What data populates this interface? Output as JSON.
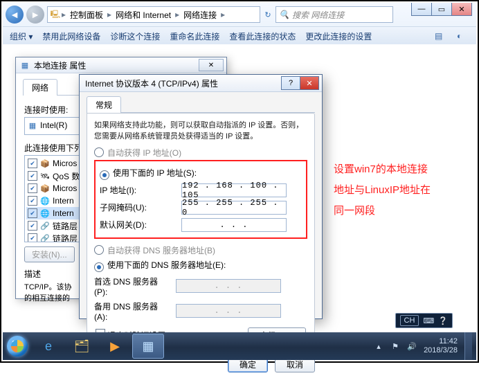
{
  "explorer": {
    "breadcrumbs": [
      "控制面板",
      "网络和 Internet",
      "网络连接"
    ],
    "search_placeholder": "搜索 网络连接",
    "commands": {
      "organize": "组织 ▾",
      "disable": "禁用此网络设备",
      "diagnose": "诊断这个连接",
      "rename": "重命名此连接",
      "status": "查看此连接的状态",
      "change": "更改此连接的设置"
    }
  },
  "win1": {
    "title": "本地连接 属性",
    "tab": "网络",
    "connect_label": "连接时使用:",
    "adapter": "Intel(R)",
    "items_label": "此连接使用下列项目(O):",
    "items": [
      {
        "chk": "✔",
        "icon": "📦",
        "text": "Micros"
      },
      {
        "chk": "✔",
        "icon": "🛰",
        "text": "QoS 数"
      },
      {
        "chk": "✔",
        "icon": "📦",
        "text": "Micros"
      },
      {
        "chk": "✔",
        "icon": "🌐",
        "text": "Intern"
      },
      {
        "chk": "✔",
        "icon": "🌐",
        "text": "Intern"
      },
      {
        "chk": "✔",
        "icon": "🔗",
        "text": "链路层"
      },
      {
        "chk": "✔",
        "icon": "🔗",
        "text": "链路层"
      }
    ],
    "install": "安装(N)...",
    "desc_label": "描述",
    "desc": "TCP/IP。该协\n的相互连接的"
  },
  "win2": {
    "title": "Internet 协议版本 4 (TCP/IPv4) 属性",
    "tab": "常规",
    "note": "如果网络支持此功能，则可以获取自动指派的 IP 设置。否则，\n您需要从网络系统管理员处获得适当的 IP 设置。",
    "auto_ip": "自动获得 IP 地址(O)",
    "use_ip": "使用下面的 IP 地址(S):",
    "ip_label": "IP 地址(I):",
    "ip": "192 . 168 . 100 . 105",
    "mask_label": "子网掩码(U):",
    "mask": "255 . 255 . 255 .  0 ",
    "gw_label": "默认网关(D):",
    "gw": " .     .     .   ",
    "auto_dns": "自动获得 DNS 服务器地址(B)",
    "use_dns": "使用下面的 DNS 服务器地址(E):",
    "dns1_label": "首选 DNS 服务器(P):",
    "dns2_label": "备用 DNS 服务器(A):",
    "dns_blank": " .     .     .   ",
    "validate": "退出时验证设置(L)",
    "advanced": "高级(V)...",
    "ok": "确定",
    "cancel": "取消"
  },
  "annot": {
    "l1": "设置win7的本地连接",
    "l2": "地址与LinuxIP地址在",
    "l3": "同一网段"
  },
  "tray": {
    "ime": "CH",
    "time": "11:42",
    "date": "2018/3/28"
  }
}
